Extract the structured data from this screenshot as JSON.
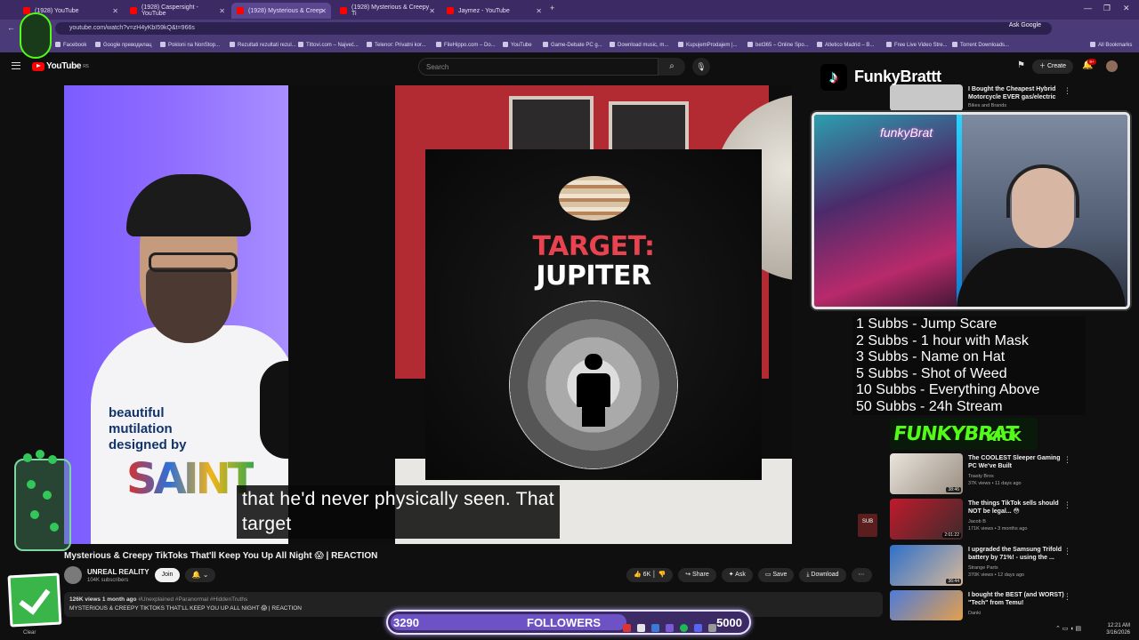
{
  "browser": {
    "tabs": [
      {
        "label": "(1928) YouTube"
      },
      {
        "label": "(1928) Caspersight - YouTube"
      },
      {
        "label": "(1928) Mysterious & Creep"
      },
      {
        "label": "(1928) Mysterious & Creepy Ti"
      },
      {
        "label": "Jaymez - YouTube"
      }
    ],
    "url": "youtube.com/watch?v=zH4yKbI59kQ&t=966s",
    "ask_google": "Ask Google",
    "bookmarks": [
      "Facebook",
      "Google преводилац",
      "Pokloni na NonStop...",
      "Rezultati rezultati rezul...",
      "Tittovi.com – Najveć...",
      "Telenor: Privatni kor...",
      "FileHippo.com – Do...",
      "YouTube",
      "Game-Debate PC g...",
      "Download music, m...",
      "KupujemProdajem |...",
      "bet365 – Online Spo...",
      "Atletico Madrid – B...",
      "Free Live Video Stre...",
      "Torrent Downloads...",
      "All Bookmarks"
    ]
  },
  "youtube": {
    "logo": "YouTube",
    "region": "RS",
    "search_placeholder": "Search",
    "create_label": "Create",
    "notification_count": "9+",
    "video": {
      "poster_title_1": "TARGET:",
      "poster_title_2": "JUPITER",
      "shirt_text": "beautiful\nmutilation\ndesigned by",
      "shirt_brand": "SAINT",
      "subtitle_line1": "that he'd never physically seen. That",
      "subtitle_line2": "target",
      "bug_label": "SUB"
    },
    "title": "Mysterious & Creepy TikToks That'll Keep You Up All Night 😱 | REACTION",
    "channel": {
      "name": "UNREAL REALITY",
      "subs": "104K subscribers"
    },
    "join_label": "Join",
    "actions": {
      "likes": "6K",
      "share": "Share",
      "ask": "Ask",
      "save": "Save",
      "download": "Download"
    },
    "description": {
      "meta": "126K views  1 month ago",
      "tags": "#Unexplained #Paranormal #HiddenTruths",
      "text": "MYSTERIOUS & CREEPY TIKTOKS THAT'LL KEEP YOU UP ALL NIGHT 😱 | REACTION"
    },
    "sidebar": [
      {
        "title": "I Bought the Cheapest Hybrid Motorcycle EVER gas/electric",
        "channel": "Bikes and Brands",
        "meta": "",
        "duration": ""
      },
      {
        "title": "The COOLEST Sleeper Gaming PC We've Built",
        "channel": "Toasty Bros",
        "meta": "37K views • 11 days ago",
        "duration": "38:46"
      },
      {
        "title": "The things TikTok sells should NOT be legal... 😳",
        "channel": "Jacob B",
        "meta": "171K views • 3 months ago",
        "duration": "2:01:22"
      },
      {
        "title": "I upgraded the Samsung Trifold battery by 71%! - using the ...",
        "channel": "Strange Parts",
        "meta": "370K views • 12 days ago",
        "duration": "36:44"
      },
      {
        "title": "I bought the BEST (and WORST) \"Tech\" from Temu!",
        "channel": "Danki",
        "meta": "",
        "duration": ""
      }
    ]
  },
  "stream_overlay": {
    "tiktok_name": "FunkyBrattt",
    "webcam_sign": "funkyBrat",
    "sub_goals": [
      "1 Subbs - Jump Scare",
      "2 Subbs - 1 hour with Mask",
      "3 Subbs - Name on Hat",
      "5 Subbs - Shot of Weed",
      "10 Subbs - Everything Above",
      "50 Subbs - 24h Stream"
    ],
    "kick_banner": {
      "name": "FUNKYBRAT",
      "platform": "KICK"
    },
    "followers": {
      "current": "3290",
      "label": "FOLLOWERS",
      "goal": "5000",
      "progress": 0.658
    },
    "clear_label": "Clear"
  },
  "taskbar": {
    "time": "12:21 AM",
    "date": "3/16/2026"
  },
  "colors": {
    "tab_bar": "#3b2a63",
    "accent_purple": "#6c52c4",
    "kick_green": "#53fc18",
    "yt_red": "#ff0000"
  }
}
